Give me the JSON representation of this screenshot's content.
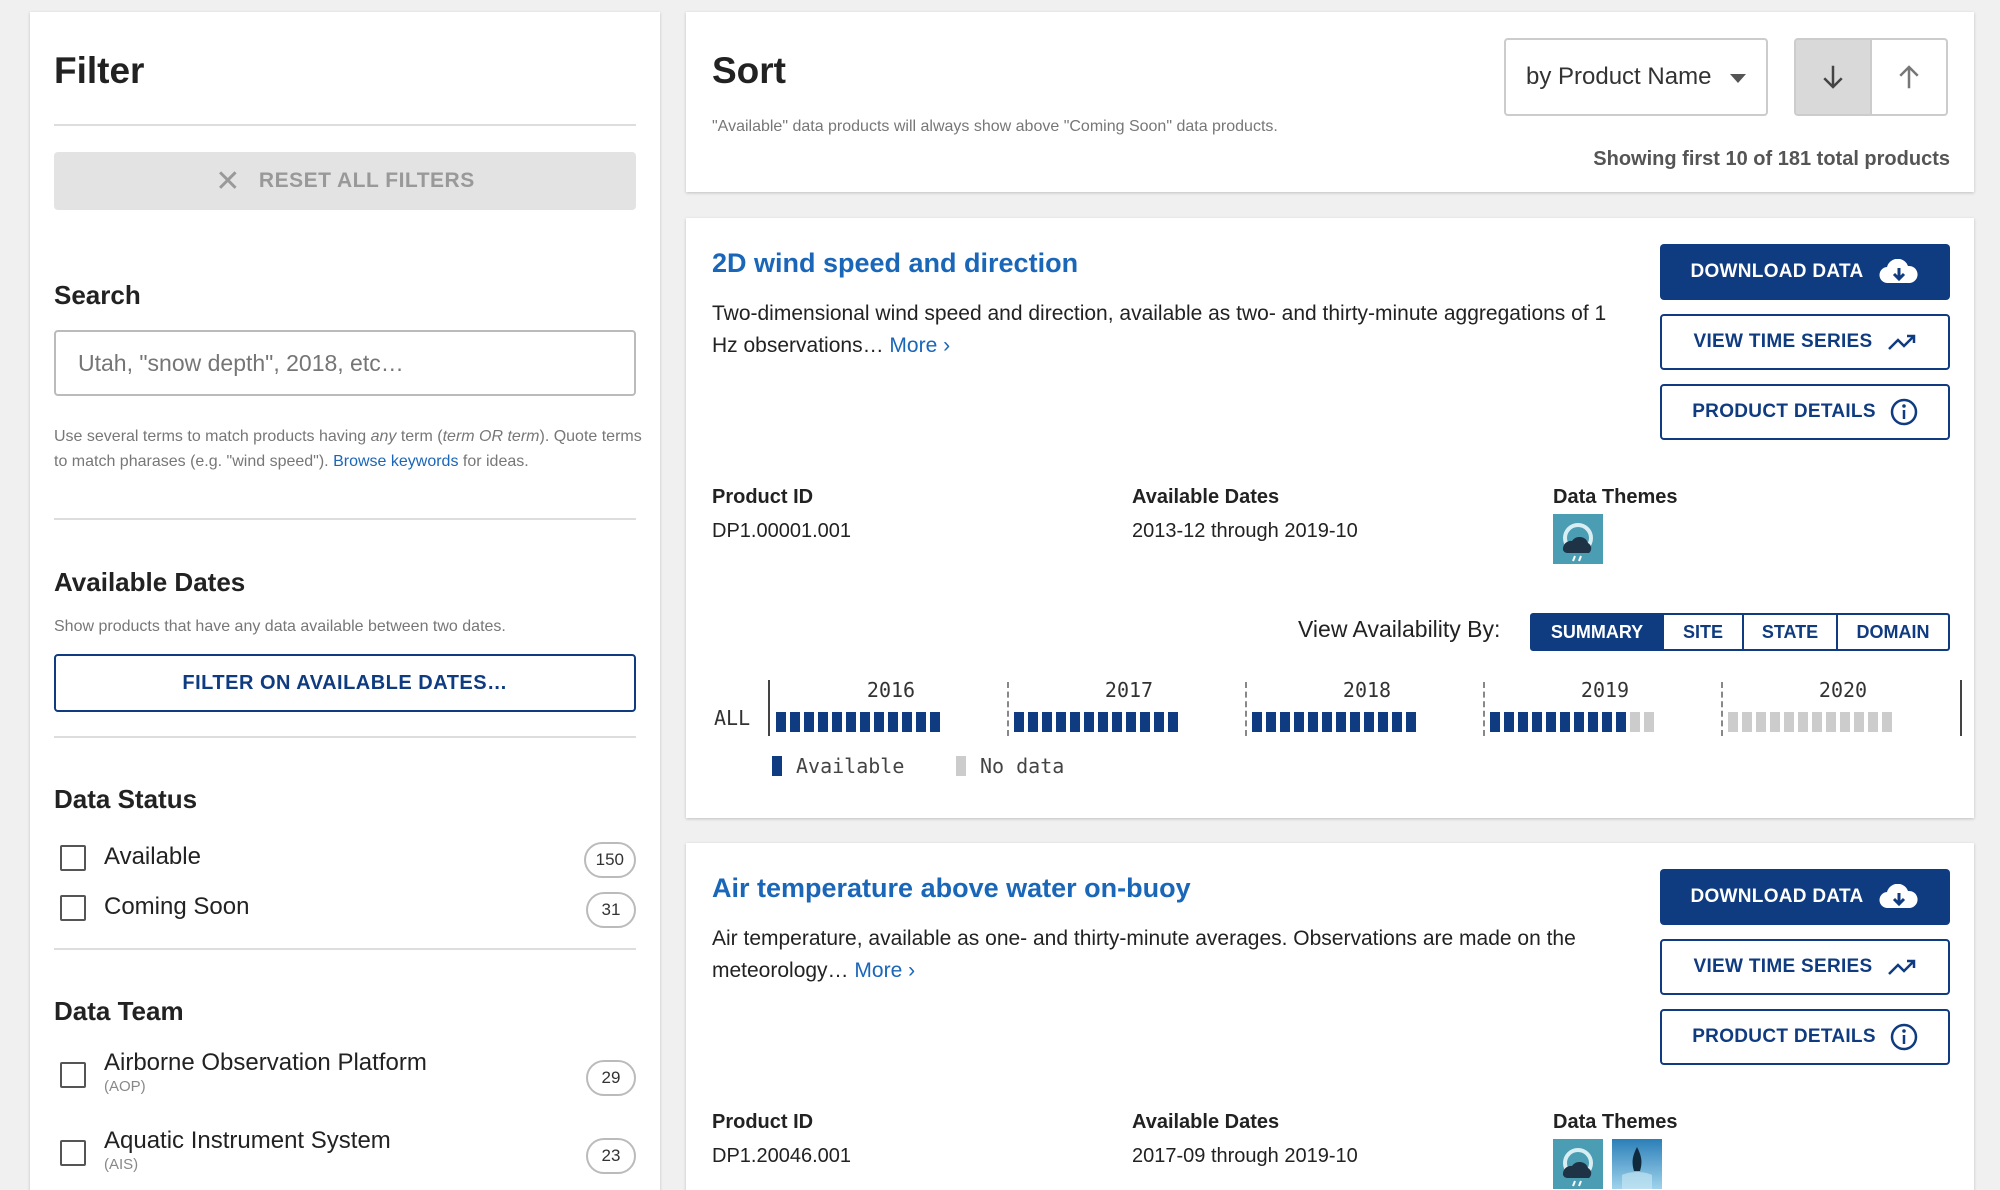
{
  "filter": {
    "title": "Filter",
    "reset_label": "RESET ALL FILTERS",
    "search": {
      "title": "Search",
      "placeholder": "Utah, \"snow depth\", 2018, etc…",
      "help_1": "Use several terms to match products having ",
      "help_any": "any",
      "help_2": " term (",
      "help_or": "term OR term",
      "help_3": "). Quote terms to match pharases (e.g. \"wind speed\"). ",
      "help_link": "Browse keywords",
      "help_4": " for ideas."
    },
    "dates": {
      "title": "Available Dates",
      "help": "Show products that have any data available between two dates.",
      "button": "FILTER ON AVAILABLE DATES…"
    },
    "status": {
      "title": "Data Status",
      "options": [
        {
          "label": "Available",
          "count": "150"
        },
        {
          "label": "Coming Soon",
          "count": "31"
        }
      ]
    },
    "team": {
      "title": "Data Team",
      "options": [
        {
          "label": "Airborne Observation Platform",
          "sub": "(AOP)",
          "count": "29"
        },
        {
          "label": "Aquatic Instrument System",
          "sub": "(AIS)",
          "count": "23"
        }
      ]
    }
  },
  "sort": {
    "title": "Sort",
    "note": "\"Available\" data products will always show above \"Coming Soon\" data products.",
    "selected": "by Product Name",
    "direction": "descending",
    "count_text": "Showing first 10 of 181 total products"
  },
  "colors": {
    "navy": "#0f3b80",
    "link": "#1a66b8",
    "nodata": "#cccccc"
  },
  "products": [
    {
      "title": "2D wind speed and direction",
      "desc": "Two-dimensional wind speed and direction, available as two- and thirty-minute aggregations of 1 Hz observations…",
      "more": "More",
      "buttons": {
        "download": "DOWNLOAD DATA",
        "timeseries": "VIEW TIME SERIES",
        "details": "PRODUCT DETAILS"
      },
      "id_label": "Product ID",
      "id": "DP1.00001.001",
      "dates_label": "Available Dates",
      "dates": "2013-12 through 2019-10",
      "themes_label": "Data Themes",
      "themes": [
        "atmosphere-icon"
      ],
      "availability": {
        "label": "View Availability By:",
        "views": [
          "SUMMARY",
          "SITE",
          "STATE",
          "DOMAIN"
        ],
        "selected": "SUMMARY",
        "row_label": "ALL",
        "years": [
          "2016",
          "2017",
          "2018",
          "2019",
          "2020"
        ],
        "legend": {
          "available": "Available",
          "nodata": "No data"
        }
      }
    },
    {
      "title": "Air temperature above water on-buoy",
      "desc": "Air temperature, available as one- and thirty-minute averages. Observations are made on the meteorology…",
      "more": "More",
      "buttons": {
        "download": "DOWNLOAD DATA",
        "timeseries": "VIEW TIME SERIES",
        "details": "PRODUCT DETAILS"
      },
      "id_label": "Product ID",
      "id": "DP1.20046.001",
      "dates_label": "Available Dates",
      "dates": "2017-09 through 2019-10",
      "themes_label": "Data Themes",
      "themes": [
        "atmosphere-icon",
        "freshwater-icon"
      ]
    }
  ]
}
